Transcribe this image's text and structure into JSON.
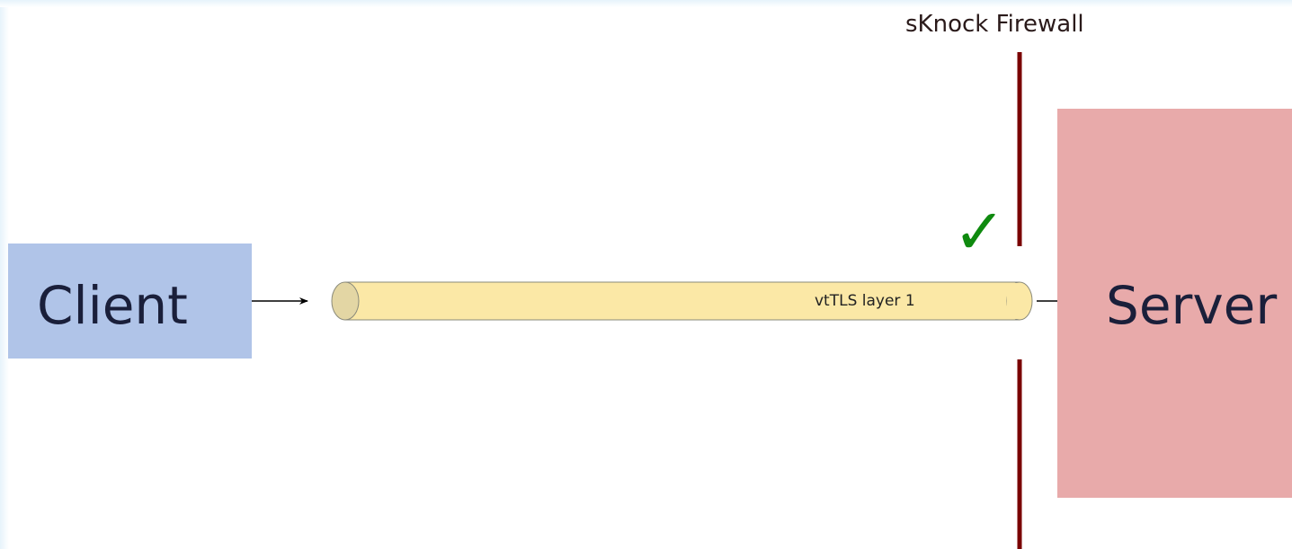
{
  "diagram": {
    "client_label": "Client",
    "server_label": "Server",
    "firewall_label": "sKnock Firewall",
    "tunnel_label": "vtTLS layer 1",
    "check_symbol": "✓"
  },
  "colors": {
    "client_fill": "#b0c4e8",
    "server_fill": "#e8aaaa",
    "tunnel_fill": "#fbe8a6",
    "tunnel_cap": "#e3d6a4",
    "firewall_line": "#7a0000",
    "checkmark": "#0f8a0f",
    "arrow": "#000000",
    "left_gradient": "#e7f3fb"
  },
  "icons": {
    "check": "checkmark-icon"
  }
}
